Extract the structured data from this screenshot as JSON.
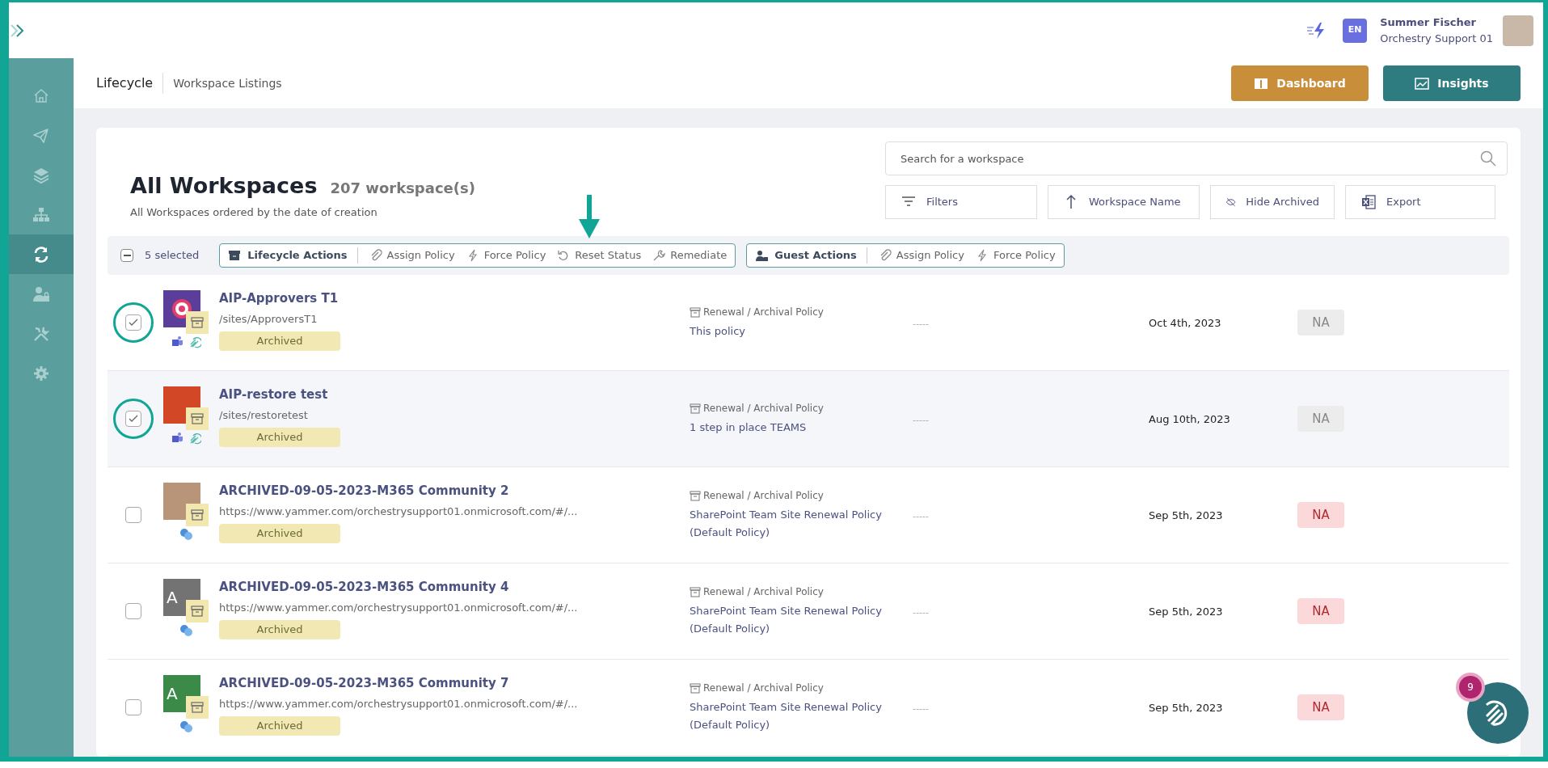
{
  "topbar": {
    "language": "EN",
    "user_name": "Summer Fischer",
    "user_org": "Orchestry Support 01"
  },
  "sidebar": {
    "items": [
      {
        "selected": false
      },
      {
        "selected": false
      },
      {
        "selected": false
      },
      {
        "selected": false
      },
      {
        "selected": true
      },
      {
        "selected": false
      },
      {
        "selected": false
      },
      {
        "selected": false
      }
    ]
  },
  "breadcrumb": [
    "Lifecycle",
    "Workspace Listings"
  ],
  "header_buttons": [
    {
      "label": "Dashboard",
      "kind": "dashboard"
    },
    {
      "label": "Insights",
      "kind": "insights"
    }
  ],
  "title": "All Workspaces",
  "count": "207 workspace(s)",
  "subtitle": "All Workspaces ordered by the date of creation",
  "search": {
    "placeholder": "Search for a workspace"
  },
  "toolbar": [
    "Filters",
    "Workspace Name",
    "Hide Archived",
    "Export"
  ],
  "selection": {
    "label": "5 selected",
    "partial": true
  },
  "action_groups": [
    {
      "title": "Lifecycle Actions",
      "actions": [
        {
          "label": "Assign Policy",
          "kind": "assign"
        },
        {
          "label": "Force Policy",
          "kind": "force"
        },
        {
          "label": "Reset Status",
          "kind": "reset"
        },
        {
          "label": "Remediate",
          "kind": "remediate"
        }
      ]
    },
    {
      "title": "Guest Actions",
      "actions": [
        {
          "label": "Assign Policy",
          "kind": "assign"
        },
        {
          "label": "Force Policy",
          "kind": "force"
        }
      ]
    }
  ],
  "rows": [
    {
      "checked": true,
      "circled": true,
      "highlighted": false,
      "thumb": {
        "kind": "target",
        "color": "#5b3d9a"
      },
      "apps": [
        {
          "kind": "teams"
        },
        {
          "kind": "orchestry"
        }
      ],
      "name": "AIP-Approvers T1",
      "url": "/sites/ApproversT1",
      "status": "Archived",
      "policy_type": "Renewal / Archival Policy",
      "policy": "This policy",
      "column_3": "-----",
      "date": "Oct 4th, 2023",
      "badge": {
        "label": "NA",
        "kind": "neutral"
      }
    },
    {
      "checked": true,
      "circled": true,
      "highlighted": true,
      "thumb": {
        "kind": "plain",
        "color": "#d24726"
      },
      "apps": [
        {
          "kind": "teams"
        },
        {
          "kind": "orchestry"
        }
      ],
      "name": "AIP-restore test",
      "url": "/sites/restoretest",
      "status": "Archived",
      "policy_type": "Renewal / Archival Policy",
      "policy": "1 step in place TEAMS",
      "column_3": "-----",
      "date": "Aug 10th, 2023",
      "badge": {
        "label": "NA",
        "kind": "neutral"
      }
    },
    {
      "checked": false,
      "circled": false,
      "highlighted": false,
      "thumb": {
        "kind": "photo",
        "color": "#b89478"
      },
      "apps": [
        {
          "kind": "yammer"
        }
      ],
      "name": "ARCHIVED-09-05-2023-M365 Community 2",
      "url": "https://www.yammer.com/orchestrysupport01.onmicrosoft.com/#/...",
      "status": "Archived",
      "policy_type": "Renewal / Archival Policy",
      "policy": "SharePoint Team Site Renewal Policy (Default Policy)",
      "column_3": "-----",
      "date": "Sep 5th, 2023",
      "badge": {
        "label": "NA",
        "kind": "danger"
      }
    },
    {
      "checked": false,
      "circled": false,
      "highlighted": false,
      "thumb": {
        "kind": "letter",
        "color": "#737373",
        "text": "A"
      },
      "apps": [
        {
          "kind": "yammer"
        }
      ],
      "name": "ARCHIVED-09-05-2023-M365 Community 4",
      "url": "https://www.yammer.com/orchestrysupport01.onmicrosoft.com/#/...",
      "status": "Archived",
      "policy_type": "Renewal / Archival Policy",
      "policy": "SharePoint Team Site Renewal Policy (Default Policy)",
      "column_3": "-----",
      "date": "Sep 5th, 2023",
      "badge": {
        "label": "NA",
        "kind": "danger"
      }
    },
    {
      "checked": false,
      "circled": false,
      "highlighted": false,
      "thumb": {
        "kind": "letter",
        "color": "#3b8a47",
        "text": "A"
      },
      "apps": [
        {
          "kind": "yammer"
        }
      ],
      "name": "ARCHIVED-09-05-2023-M365 Community 7",
      "url": "https://www.yammer.com/orchestrysupport01.onmicrosoft.com/#/...",
      "status": "Archived",
      "policy_type": "Renewal / Archival Policy",
      "policy": "SharePoint Team Site Renewal Policy (Default Policy)",
      "column_3": "-----",
      "date": "Sep 5th, 2023",
      "badge": {
        "label": "NA",
        "kind": "danger"
      }
    }
  ],
  "help": {
    "badge": "9"
  }
}
